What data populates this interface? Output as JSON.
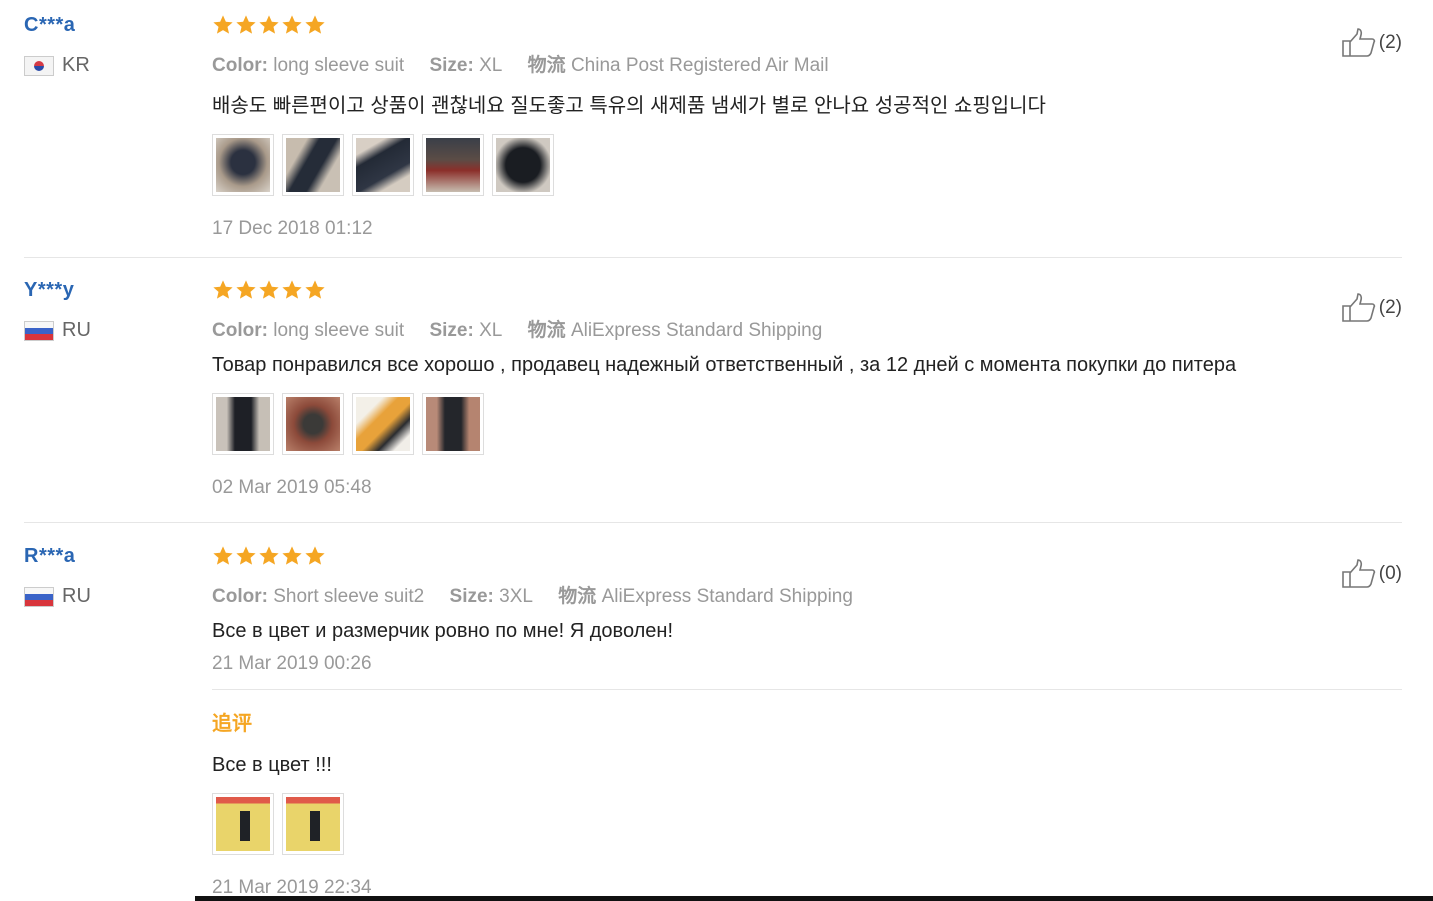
{
  "reviews": [
    {
      "user": "C***a",
      "country_code": "KR",
      "stars": 5,
      "color_label": "Color:",
      "color_value": "long sleeve suit",
      "size_label": "Size:",
      "size_value": "XL",
      "shipping_label": "物流",
      "shipping_value": "China Post Registered Air Mail",
      "text": "배송도 빠른편이고 상품이 괜찮네요 질도좋고 특유의 새제품 냄세가 별로 안나요 성공적인 쇼핑입니다",
      "photos": 5,
      "date": "17 Dec 2018 01:12",
      "likes": "(2)"
    },
    {
      "user": "Y***y",
      "country_code": "RU",
      "stars": 5,
      "color_label": "Color:",
      "color_value": "long sleeve suit",
      "size_label": "Size:",
      "size_value": "XL",
      "shipping_label": "物流",
      "shipping_value": "AliExpress Standard Shipping",
      "text": "Товар понравился все хорошо , продавец надежный ответственный , за 12 дней с момента покупки до питера",
      "photos": 4,
      "date": "02 Mar 2019 05:48",
      "likes": "(2)"
    },
    {
      "user": "R***a",
      "country_code": "RU",
      "stars": 5,
      "color_label": "Color:",
      "color_value": "Short sleeve suit2",
      "size_label": "Size:",
      "size_value": "3XL",
      "shipping_label": "物流",
      "shipping_value": "AliExpress Standard Shipping",
      "text": "Все в цвет и размерчик ровно по мне! Я доволен!",
      "date": "21 Mar 2019 00:26",
      "likes": "(0)",
      "followup": {
        "title": "追评",
        "text": "Все в цвет !!!",
        "photos": 2,
        "date": "21 Mar 2019 22:34"
      }
    }
  ],
  "colors": {
    "username": "#2a66b3",
    "star": "#f5a623",
    "followup": "#f5a623"
  }
}
